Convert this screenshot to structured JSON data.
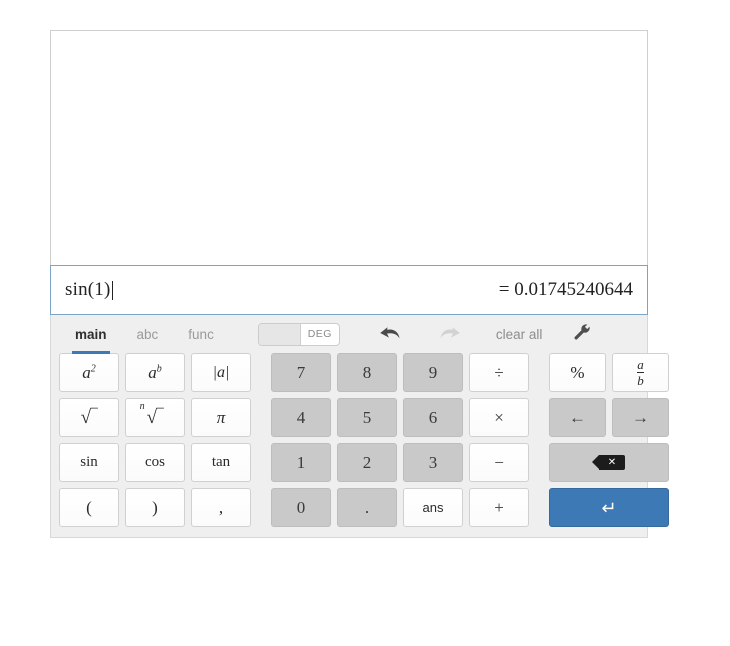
{
  "display": {
    "history": [],
    "expression": "sin(1)",
    "result": "= 0.01745240644"
  },
  "toolbar": {
    "tabs": [
      {
        "label": "main",
        "active": true
      },
      {
        "label": "abc",
        "active": false
      },
      {
        "label": "func",
        "active": false
      }
    ],
    "angle_mode": "DEG",
    "undo_label": "undo",
    "redo_label": "redo",
    "clear_all_label": "clear all",
    "settings_label": "settings"
  },
  "keys": {
    "functions": [
      {
        "label": "a2",
        "kind": "pow2"
      },
      {
        "label": "ab",
        "kind": "powb"
      },
      {
        "label": "|a|",
        "kind": "abs"
      },
      {
        "label": "sqrt",
        "kind": "sqrt"
      },
      {
        "label": "nroot",
        "kind": "nroot"
      },
      {
        "label": "π",
        "kind": "pi"
      },
      {
        "label": "sin",
        "kind": "word"
      },
      {
        "label": "cos",
        "kind": "word"
      },
      {
        "label": "tan",
        "kind": "word"
      },
      {
        "label": "(",
        "kind": "paren"
      },
      {
        "label": ")",
        "kind": "paren"
      },
      {
        "label": ",",
        "kind": "paren"
      }
    ],
    "numpad": [
      {
        "label": "7",
        "style": "gray"
      },
      {
        "label": "8",
        "style": "gray"
      },
      {
        "label": "9",
        "style": "gray"
      },
      {
        "label": "÷",
        "style": "white"
      },
      {
        "label": "4",
        "style": "gray"
      },
      {
        "label": "5",
        "style": "gray"
      },
      {
        "label": "6",
        "style": "gray"
      },
      {
        "label": "×",
        "style": "white"
      },
      {
        "label": "1",
        "style": "gray"
      },
      {
        "label": "2",
        "style": "gray"
      },
      {
        "label": "3",
        "style": "gray"
      },
      {
        "label": "−",
        "style": "white"
      },
      {
        "label": "0",
        "style": "gray"
      },
      {
        "label": ".",
        "style": "gray"
      },
      {
        "label": "ans",
        "style": "white"
      },
      {
        "label": "+",
        "style": "white"
      }
    ],
    "edit": {
      "percent": "%",
      "fraction_numerator": "a",
      "fraction_denominator": "b",
      "arrow_left": "←",
      "arrow_right": "→",
      "backspace": "⌫",
      "enter": "↵"
    }
  },
  "colors": {
    "accent": "#3d7ab5",
    "input_border": "#7ba4c6",
    "key_gray": "#c9c9c9",
    "panel_bg": "#efefef"
  }
}
